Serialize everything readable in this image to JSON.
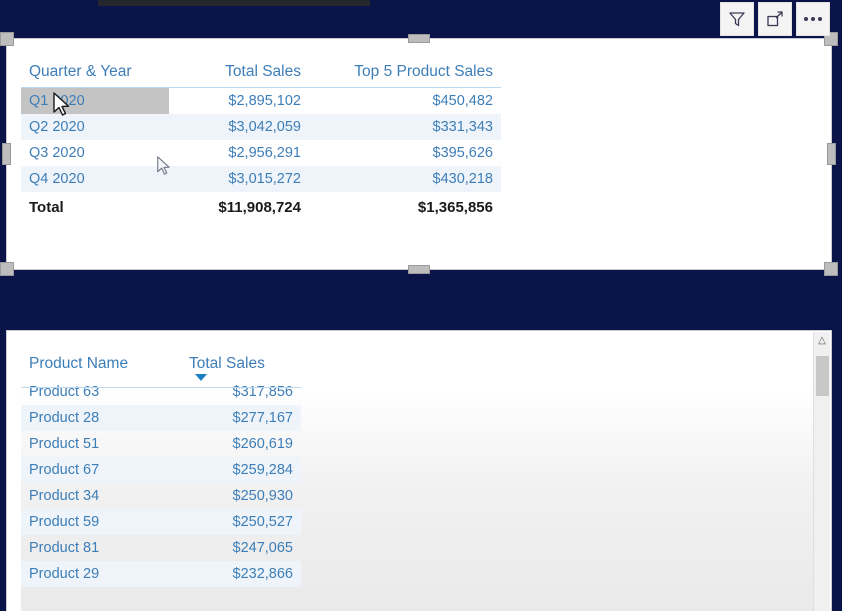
{
  "visual_toolbar": {
    "filter_icon": "filter-icon",
    "focus_icon": "focus-mode-icon",
    "more_icon": "more-options-icon"
  },
  "summary_visual": {
    "columns": [
      "Quarter & Year",
      "Total Sales",
      "Top 5 Product Sales"
    ],
    "rows": [
      {
        "quarter": "Q1 2020",
        "total_sales": "$2,895,102",
        "top5": "$450,482"
      },
      {
        "quarter": "Q2 2020",
        "total_sales": "$3,042,059",
        "top5": "$331,343"
      },
      {
        "quarter": "Q3 2020",
        "total_sales": "$2,956,291",
        "top5": "$395,626"
      },
      {
        "quarter": "Q4 2020",
        "total_sales": "$3,015,272",
        "top5": "$430,218"
      }
    ],
    "total_row": {
      "label": "Total",
      "total_sales": "$11,908,724",
      "top5": "$1,365,856"
    }
  },
  "products_visual": {
    "columns": [
      "Product Name",
      "Total Sales"
    ],
    "sorted_column": "Total Sales",
    "sort_direction": "descending",
    "rows": [
      {
        "name": "Product 63",
        "total_sales": "$317,856"
      },
      {
        "name": "Product 28",
        "total_sales": "$277,167"
      },
      {
        "name": "Product 51",
        "total_sales": "$260,619"
      },
      {
        "name": "Product 67",
        "total_sales": "$259,284"
      },
      {
        "name": "Product 34",
        "total_sales": "$250,930"
      },
      {
        "name": "Product 59",
        "total_sales": "$250,527"
      },
      {
        "name": "Product 81",
        "total_sales": "$247,065"
      },
      {
        "name": "Product 29",
        "total_sales": "$232,866"
      }
    ],
    "scrollbar": {
      "up_arrow": "chevron-up-icon"
    }
  },
  "colors": {
    "canvas_background": "#0b1448",
    "text_blue": "#3d7eb8",
    "header_rule": "#bcd9ef",
    "stripe": "#eef4f9",
    "cell_hover": "#c4c4c4",
    "total_text": "#1a1a1a",
    "sort_arrow": "#1b7fc4"
  }
}
